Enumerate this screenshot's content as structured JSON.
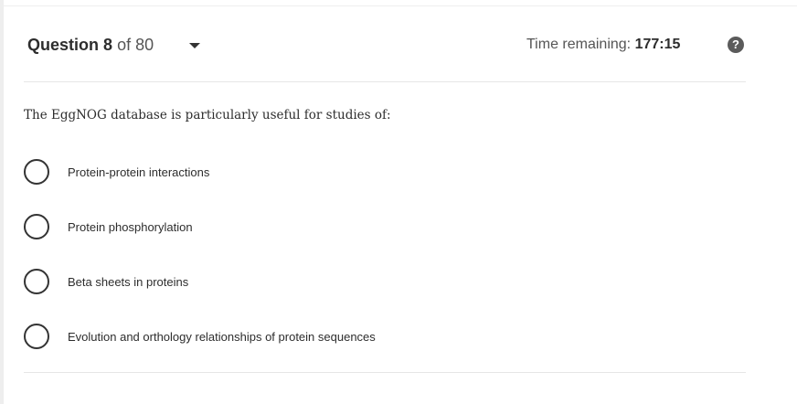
{
  "question": {
    "label": "Question",
    "number": "8",
    "of_text": "of 80",
    "prompt": "The EggNOG database is particularly useful for studies of:"
  },
  "timer": {
    "label": "Time remaining:",
    "value": "177:15"
  },
  "icons": {
    "dropdown": "chevron-down-icon",
    "help": "help-circle-icon",
    "help_glyph": "?"
  },
  "options": [
    {
      "label": "Protein-protein interactions",
      "selected": false
    },
    {
      "label": "Protein phosphorylation",
      "selected": false
    },
    {
      "label": "Beta sheets in proteins",
      "selected": false
    },
    {
      "label": "Evolution and orthology relationships of protein sequences",
      "selected": false
    }
  ],
  "colors": {
    "text": "#2d2d2d",
    "muted": "#555555",
    "divider": "#e6e6e6",
    "radio_border": "#333333"
  }
}
